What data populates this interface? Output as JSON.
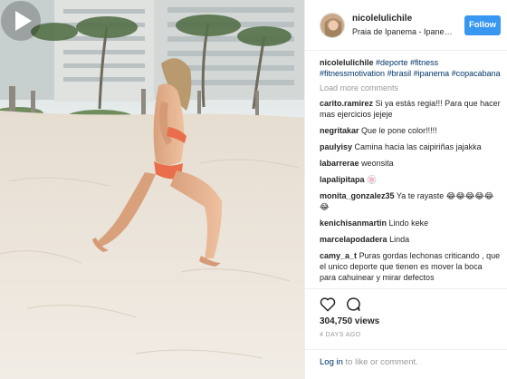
{
  "header": {
    "username": "nicolelulichile",
    "location": "Praia de Ipanema - Ipane…",
    "follow_label": "Follow"
  },
  "caption": {
    "username": "nicolelulichile",
    "hashtags": [
      "#deporte",
      "#fitness",
      "#fitnessmotivation",
      "#brasil",
      "#ipanema",
      "#copacabana"
    ]
  },
  "load_more_label": "Load more comments",
  "comments": [
    {
      "user": "carito.ramirez",
      "text": "Si ya estás regia!!! Para que hacer mas ejercicios jejeje"
    },
    {
      "user": "negritakar",
      "text": "Que le pone color!!!!!"
    },
    {
      "user": "paulyisy",
      "text": "Camina hacia las caipiriñas jajakka"
    },
    {
      "user": "labarrerae",
      "text": "weonsita"
    },
    {
      "user": "lapalipitapa",
      "text": "🍥"
    },
    {
      "user": "monita_gonzalez35",
      "text": "Ya te rayaste 😂😂😂😂😂😂"
    },
    {
      "user": "kenichisanmartin",
      "text": "Lindo keke"
    },
    {
      "user": "marcelapodadera",
      "text": "Linda"
    },
    {
      "user": "camy_a_t",
      "text": "Puras gordas lechonas criticando , que el unico deporte que tienen es mover la boca para cahuinear y mirar defectos"
    }
  ],
  "stats": {
    "views": "304,750 views",
    "time_ago": "4 DAYS AGO"
  },
  "login": {
    "login_link": "Log in",
    "suffix": " to like or comment."
  },
  "icons": {
    "heart": "heart-icon",
    "comment": "comment-bubble-icon",
    "play": "play-icon"
  },
  "colors": {
    "follow_button": "#3897f0",
    "hashtag": "#003569",
    "muted": "#999999",
    "border": "#efefef"
  }
}
